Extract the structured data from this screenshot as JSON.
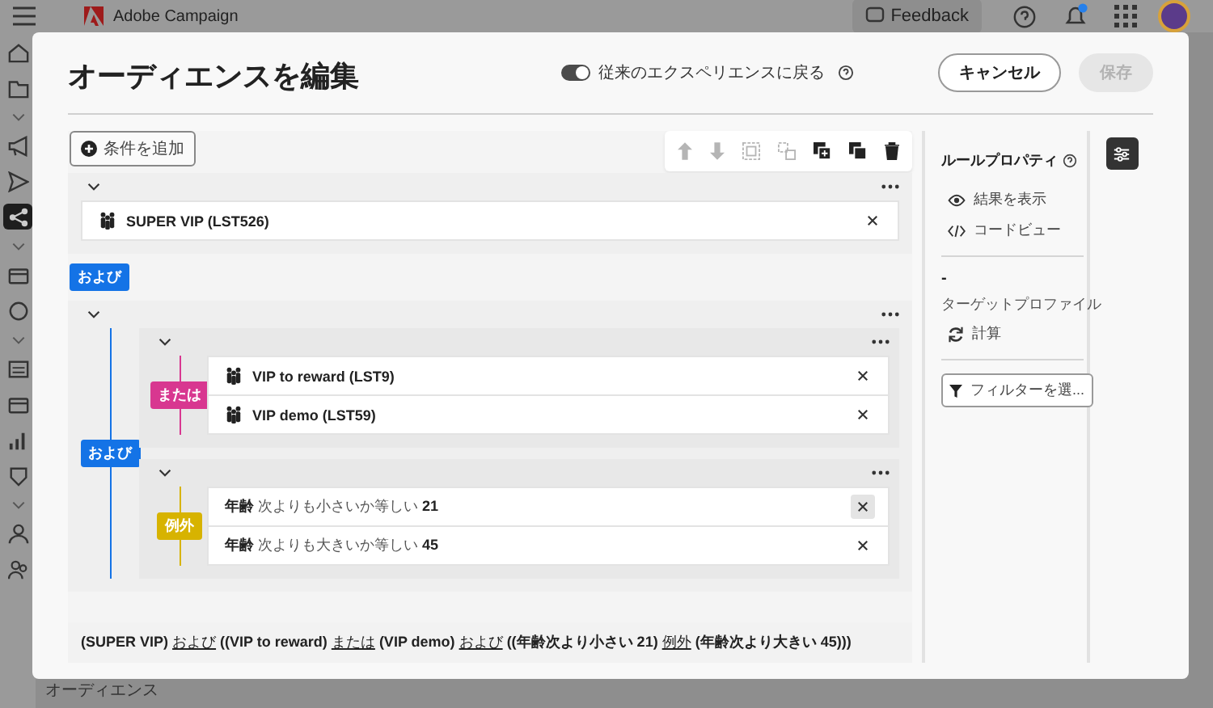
{
  "app": {
    "title": "Adobe Campaign",
    "feedback": "Feedback",
    "bottom_label": "オーディエンス"
  },
  "sidebar": [
    {
      "kind": "home",
      "selected": false
    },
    {
      "kind": "folder",
      "selected": false
    },
    {
      "kind": "chevron",
      "selected": false
    },
    {
      "kind": "megaphone",
      "selected": false
    },
    {
      "kind": "send",
      "selected": false
    },
    {
      "kind": "workflow",
      "selected": true
    },
    {
      "kind": "chevron",
      "selected": false
    },
    {
      "kind": "card",
      "selected": false
    },
    {
      "kind": "circle",
      "selected": false
    },
    {
      "kind": "chevron",
      "selected": false
    },
    {
      "kind": "list",
      "selected": false
    },
    {
      "kind": "card",
      "selected": false
    },
    {
      "kind": "chart",
      "selected": false
    },
    {
      "kind": "shield",
      "selected": false
    },
    {
      "kind": "chevron",
      "selected": false
    },
    {
      "kind": "person",
      "selected": false
    },
    {
      "kind": "people",
      "selected": false
    }
  ],
  "modal": {
    "title": "オーディエンスを編集",
    "toggle": {
      "label": "従来のエクスペリエンスに戻る",
      "on": true
    },
    "buttons": [
      {
        "label": "キャンセル",
        "disabled": false
      },
      {
        "label": "保存",
        "disabled": true
      }
    ]
  },
  "add_condition": "条件を追加",
  "toolbar": [
    {
      "kind": "up",
      "disabled": true
    },
    {
      "kind": "down",
      "disabled": true
    },
    {
      "kind": "group",
      "disabled": true
    },
    {
      "kind": "ungroup",
      "disabled": true
    },
    {
      "kind": "copy-add",
      "disabled": false
    },
    {
      "kind": "copy",
      "disabled": false
    },
    {
      "kind": "delete",
      "disabled": false
    }
  ],
  "rules": [
    {
      "kind": "group",
      "items": [
        {
          "kind": "audience",
          "label": "SUPER VIP (LST526)",
          "hover": false
        }
      ]
    },
    {
      "kind": "operator",
      "label": "および",
      "color": "#1473e6"
    },
    {
      "kind": "nested",
      "operator": {
        "label": "および",
        "color": "#1473e6"
      },
      "children": [
        {
          "operator": {
            "label": "または",
            "color": "#d83790"
          },
          "items": [
            {
              "kind": "audience",
              "label": "VIP to reward (LST9)",
              "hover": false
            },
            {
              "kind": "audience",
              "label": "VIP demo (LST59)",
              "hover": false
            }
          ]
        },
        {
          "operator": {
            "label": "例外",
            "color": "#d7b300"
          },
          "items": [
            {
              "kind": "condition",
              "field": "年齢",
              "op": "次よりも小さいか等しい",
              "value": "21",
              "hover": true
            },
            {
              "kind": "condition",
              "field": "年齢",
              "op": "次よりも大きいか等しい",
              "value": "45",
              "hover": false
            }
          ]
        }
      ]
    }
  ],
  "expression": [
    {
      "kind": "text",
      "text": "(SUPER VIP)"
    },
    {
      "kind": "operator",
      "text": "および"
    },
    {
      "kind": "text",
      "text": "((VIP to reward)"
    },
    {
      "kind": "operator",
      "text": "または"
    },
    {
      "kind": "text",
      "text": "(VIP demo)"
    },
    {
      "kind": "operator",
      "text": "および"
    },
    {
      "kind": "text",
      "text": "((年齢次より小さい 21)"
    },
    {
      "kind": "operator",
      "text": "例外"
    },
    {
      "kind": "text",
      "text": "(年齢次より大きい 45)))"
    }
  ],
  "properties": {
    "title": "ルールプロパティ",
    "actions": [
      {
        "kind": "eye",
        "label": "結果を表示"
      },
      {
        "kind": "code",
        "label": "コードビュー"
      }
    ],
    "count": "-",
    "count_label": "ターゲットプロファイル",
    "calculate": "計算",
    "filter": "フィルターを選..."
  }
}
